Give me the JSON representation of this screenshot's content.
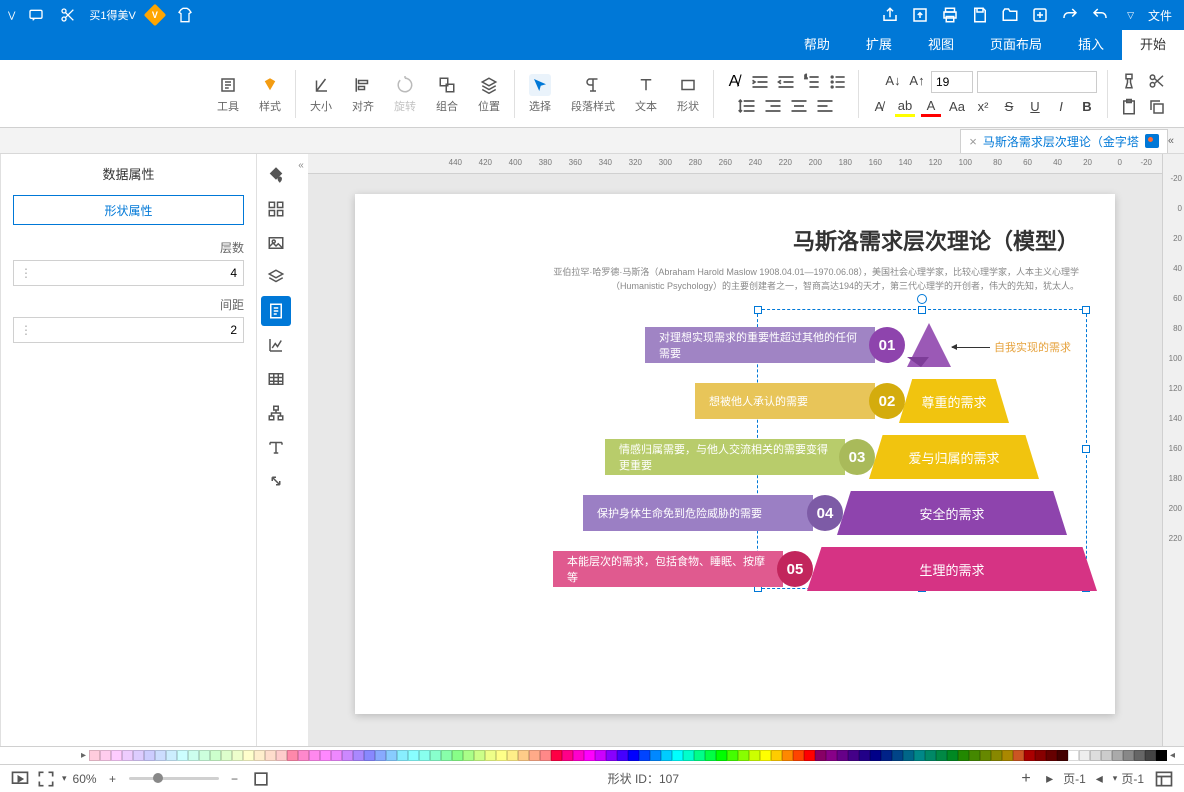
{
  "titlebar": {
    "file_menu": "文件"
  },
  "member_label": "买1得美V",
  "tabs": [
    "开始",
    "插入",
    "页面布局",
    "视图",
    "扩展",
    "帮助"
  ],
  "active_tab": 0,
  "ribbon": {
    "font_name": "",
    "font_size": "19",
    "groups": {
      "select": "选择",
      "paragraph": "段落样式",
      "text": "文本",
      "shape": "形状",
      "align": "对齐",
      "arrange": "位置",
      "combine": "组合",
      "rotate": "旋转",
      "size": "大小",
      "style": "样式",
      "tools": "工具"
    }
  },
  "doc_tab": "马斯洛需求层次理论（金字塔",
  "rpanel": {
    "title": "数据属性",
    "btn": "形状属性",
    "f1": "层数",
    "v1": "4",
    "f2": "间距",
    "v2": "2"
  },
  "page": {
    "title": "马斯洛需求层次理论（模型）",
    "sub1": "亚伯拉罕·哈罗德·马斯洛（Abraham Harold Maslow 1908.04.01—1970.06.08），美国社会心理学家，比较心理学家，人本主义心理学",
    "sub2": "（Humanistic Psychology）的主要创建者之一，智商高达194的天才，第三代心理学的开创者，伟大的先知，犹太人。",
    "anno": "自我实现的需求"
  },
  "pyramid": [
    {
      "num": "01",
      "label": "",
      "desc": "对理想实现需求的重要性超过其他的任何需要",
      "slabColor": "#9b59b6",
      "numColor": "#8e44ad",
      "descColor": "#a084c4"
    },
    {
      "num": "02",
      "label": "尊重的需求",
      "desc": "想被他人承认的需要",
      "slabColor": "#f1c40f",
      "numColor": "#d4ac0d",
      "descColor": "#e8c559"
    },
    {
      "num": "03",
      "label": "爱与归属的需求",
      "desc": "情感归属需要，与他人交流相关的需要变得更重要",
      "slabColor": "#f1c40f",
      "numColor": "#a9ba5a",
      "descColor": "#b8cc6b"
    },
    {
      "num": "04",
      "label": "安全的需求",
      "desc": "保护身体生命免到危险威胁的需要",
      "slabColor": "#8e44ad",
      "numColor": "#7d5ba6",
      "descColor": "#9b7fc4"
    },
    {
      "num": "05",
      "label": "生理的需求",
      "desc": "本能层次的需求，包括食物、睡眠、按摩等",
      "slabColor": "#d63384",
      "numColor": "#c2255c",
      "descColor": "#e05a8f"
    }
  ],
  "status": {
    "page_label": "页-1",
    "shape_id_label": "形状 ID：",
    "shape_id": "107",
    "zoom": "60%"
  },
  "colors": [
    "#000",
    "#444",
    "#666",
    "#888",
    "#aaa",
    "#ccc",
    "#ddd",
    "#eee",
    "#fff",
    "#400",
    "#600",
    "#800",
    "#a00",
    "#c52",
    "#a80",
    "#880",
    "#680",
    "#480",
    "#280",
    "#082",
    "#084",
    "#086",
    "#088",
    "#068",
    "#048",
    "#028",
    "#008",
    "#208",
    "#408",
    "#608",
    "#808",
    "#806",
    "#f00",
    "#f40",
    "#f80",
    "#fc0",
    "#ff0",
    "#cf0",
    "#8f0",
    "#4f0",
    "#0f0",
    "#0f4",
    "#0f8",
    "#0fc",
    "#0ff",
    "#0cf",
    "#08f",
    "#04f",
    "#00f",
    "#40f",
    "#80f",
    "#c0f",
    "#f0f",
    "#f0c",
    "#f08",
    "#f04",
    "#f88",
    "#fa8",
    "#fc8",
    "#fe8",
    "#ff8",
    "#ef8",
    "#cf8",
    "#af8",
    "#8f8",
    "#8fa",
    "#8fc",
    "#8fe",
    "#8ff",
    "#8ef",
    "#8cf",
    "#8af",
    "#88f",
    "#a8f",
    "#c8f",
    "#e8f",
    "#f8f",
    "#f8e",
    "#f8c",
    "#f8a",
    "#fcc",
    "#fdc",
    "#fec",
    "#ffc",
    "#efc",
    "#dfc",
    "#cfc",
    "#cfd",
    "#cfe",
    "#cff",
    "#cef",
    "#cdf",
    "#ccf",
    "#dcf",
    "#ecf",
    "#fcf",
    "#fce",
    "#fcd"
  ]
}
